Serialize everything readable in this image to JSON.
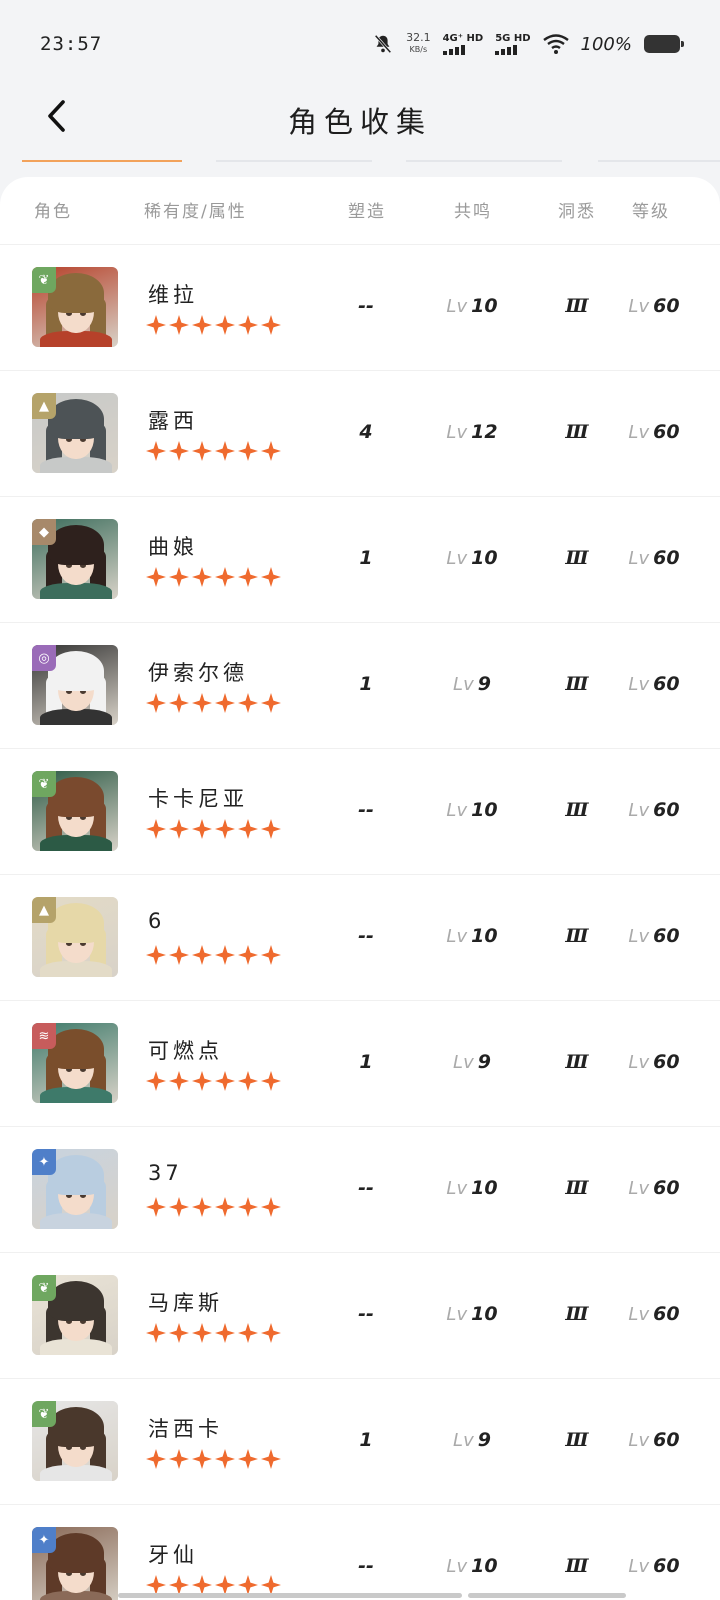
{
  "status": {
    "time": "23:57",
    "net_speed": "32.1",
    "net_unit": "KB/s",
    "sim1": "4G⁺ HD",
    "sim2": "5G HD",
    "battery": "100%"
  },
  "header": {
    "title": "角色收集"
  },
  "tabs": [
    {
      "active": true
    },
    {
      "active": false
    },
    {
      "active": false
    },
    {
      "active": false
    }
  ],
  "columns": {
    "character": "角色",
    "rarity_attr": "稀有度/属性",
    "remold": "塑造",
    "resonance": "共鸣",
    "insight": "洞悉",
    "level": "等级"
  },
  "lv_prefix": "Lv",
  "rows": [
    {
      "name": "维拉",
      "remold": "--",
      "resonance": "10",
      "insight": "Ⅲ",
      "level": "60",
      "element_icon": "leaf-icon",
      "element_color": "#6fa760",
      "stars": 6
    },
    {
      "name": "露西",
      "remold": "4",
      "resonance": "12",
      "insight": "Ⅲ",
      "level": "60",
      "element_icon": "pyramid-icon",
      "element_color": "#b5a36a",
      "stars": 6
    },
    {
      "name": "曲娘",
      "remold": "1",
      "resonance": "10",
      "insight": "Ⅲ",
      "level": "60",
      "element_icon": "mineral-icon",
      "element_color": "#a7896a",
      "stars": 6
    },
    {
      "name": "伊索尔德",
      "remold": "1",
      "resonance": "9",
      "insight": "Ⅲ",
      "level": "60",
      "element_icon": "spiral-icon",
      "element_color": "#9a6bb8",
      "stars": 6
    },
    {
      "name": "卡卡尼亚",
      "remold": "--",
      "resonance": "10",
      "insight": "Ⅲ",
      "level": "60",
      "element_icon": "leaf-icon",
      "element_color": "#6fa760",
      "stars": 6
    },
    {
      "name": "6",
      "remold": "--",
      "resonance": "10",
      "insight": "Ⅲ",
      "level": "60",
      "element_icon": "pyramid-icon",
      "element_color": "#b5a36a",
      "stars": 6
    },
    {
      "name": "可燃点",
      "remold": "1",
      "resonance": "9",
      "insight": "Ⅲ",
      "level": "60",
      "element_icon": "flame-icon",
      "element_color": "#c75c5c",
      "stars": 6
    },
    {
      "name": "37",
      "remold": "--",
      "resonance": "10",
      "insight": "Ⅲ",
      "level": "60",
      "element_icon": "star-burst-icon",
      "element_color": "#4f7fc9",
      "stars": 6
    },
    {
      "name": "马库斯",
      "remold": "--",
      "resonance": "10",
      "insight": "Ⅲ",
      "level": "60",
      "element_icon": "leaf-icon",
      "element_color": "#6fa760",
      "stars": 6
    },
    {
      "name": "洁西卡",
      "remold": "1",
      "resonance": "9",
      "insight": "Ⅲ",
      "level": "60",
      "element_icon": "leaf-icon",
      "element_color": "#6fa760",
      "stars": 6
    },
    {
      "name": "牙仙",
      "remold": "--",
      "resonance": "10",
      "insight": "Ⅲ",
      "level": "60",
      "element_icon": "star-burst-icon",
      "element_color": "#4f7fc9",
      "stars": 6
    }
  ],
  "colors": {
    "accent": "#f2a25b",
    "star": "#ef6a2e"
  }
}
